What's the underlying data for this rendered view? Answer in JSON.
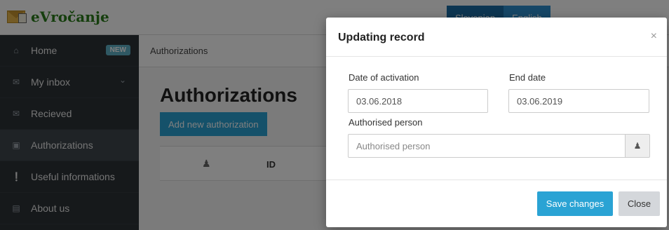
{
  "app": {
    "logo_text": "eVročanje"
  },
  "language": {
    "options": [
      "Slovenian",
      "English"
    ],
    "selected": "English"
  },
  "sidebar": {
    "items": [
      {
        "label": "Home",
        "icon": "home-icon",
        "badge": "NEW"
      },
      {
        "label": "My inbox",
        "icon": "envelope-icon",
        "expandable": true
      },
      {
        "label": "Recieved",
        "icon": "envelope-icon"
      },
      {
        "label": "Authorizations",
        "icon": "id-card-icon",
        "active": true
      },
      {
        "label": "Useful informations",
        "icon": "info-icon"
      },
      {
        "label": "About us",
        "icon": "list-icon"
      }
    ]
  },
  "main": {
    "breadcrumb": "Authorizations",
    "title": "Authorizations",
    "add_button": "Add new authorization",
    "table": {
      "columns": [
        "",
        "ID"
      ]
    }
  },
  "modal": {
    "title": "Updating record",
    "close_symbol": "×",
    "fields": {
      "date_of_activation": {
        "label": "Date of activation",
        "value": "03.06.2018"
      },
      "end_date": {
        "label": "End date",
        "value": "03.06.2019"
      },
      "authorised_person": {
        "label": "Authorised person",
        "placeholder": "Authorised person",
        "value": ""
      }
    },
    "save_button": "Save changes",
    "close_button": "Close"
  },
  "colors": {
    "primary": "#2aa3d4",
    "sidebar": "#2c3237",
    "logo": "#2a7d1a"
  }
}
